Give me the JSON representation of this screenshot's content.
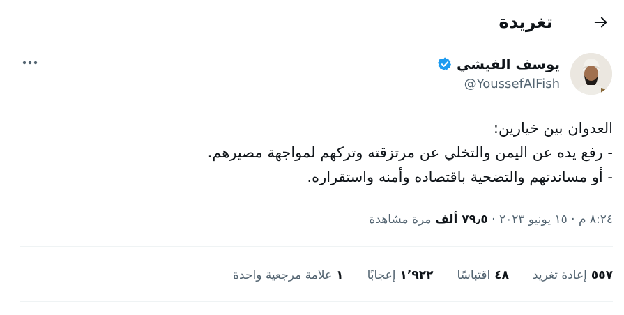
{
  "header": {
    "title": "تغريدة",
    "back_icon": "arrow-right-icon"
  },
  "author": {
    "name": "يوسف الفيشي",
    "handle": "@YoussefAlFish",
    "verified_color": "#1d9bf0"
  },
  "tweet": {
    "lines": [
      "العدوان بين خيارين:",
      "- رفع يده عن اليمن والتخلي عن مرتزقته وتركهم لمواجهة مصيرهم.",
      "- أو مساندتهم والتضحية باقتصاده وأمنه واستقراره."
    ]
  },
  "meta": {
    "time": "٨:٢٤ م",
    "sep1": " · ",
    "date": "١٥ يونيو ٢٠٢٣",
    "sep2": " · ",
    "views_count": "٧٩٫٥ ألف",
    "views_label": " مرة مشاهدة"
  },
  "stats": {
    "retweets": {
      "count": "٥٥٧",
      "label": "إعادة تغريد"
    },
    "quotes": {
      "count": "٤٨",
      "label": "اقتباسًا"
    },
    "likes": {
      "count": "١٬٩٢٢",
      "label": "إعجابًا"
    },
    "bookmarks": {
      "count": "١",
      "label": "علامة مرجعية واحدة"
    }
  }
}
